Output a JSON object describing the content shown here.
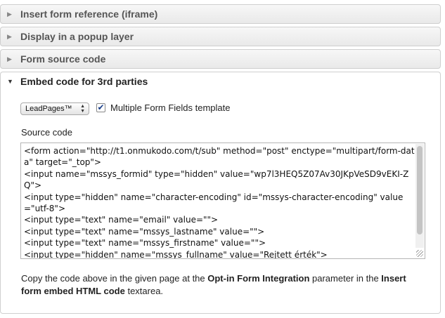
{
  "sections": [
    {
      "title": "Insert form reference (iframe)",
      "open": false
    },
    {
      "title": "Display in a popup layer",
      "open": false
    },
    {
      "title": "Form source code",
      "open": false
    },
    {
      "title": "Embed code for 3rd parties",
      "open": true
    }
  ],
  "embed": {
    "template_select": {
      "selected": "LeadPages™"
    },
    "multiple_fields_checkbox": {
      "checked": true,
      "label": "Multiple Form Fields template"
    },
    "source_code_label": "Source code",
    "source_code": "<form action=\"http://t1.onmukodo.com/t/sub\" method=\"post\" enctype=\"multipart/form-data\" target=\"_top\">\n<input name=\"mssys_formid\" type=\"hidden\" value=\"wp7l3HEQ5Z07Av30JKpVeSD9vEKI-ZQ\">\n<input type=\"hidden\" name=\"character-encoding\" id=\"mssys-character-encoding\" value=\"utf-8\">\n<input type=\"text\" name=\"email\" value=\"\">\n<input type=\"text\" name=\"mssys_lastname\" value=\"\">\n<input type=\"text\" name=\"mssys_firstname\" value=\"\">\n<input type=\"hidden\" name=\"mssys_fullname\" value=\"Rejtett érték\">",
    "instructions": {
      "part1": "Copy the code above in the given page at the ",
      "bold1": "Opt-in Form Integration",
      "part2": " parameter in the ",
      "bold2": "Insert form embed HTML code",
      "part3": " textarea."
    }
  },
  "colors": {
    "header_bg": "#ececec",
    "border": "#cfcfcf",
    "checkbox_mark": "#1a3f8a"
  },
  "icons": {
    "collapsed": "triangle-right-icon",
    "expanded": "triangle-down-icon"
  }
}
